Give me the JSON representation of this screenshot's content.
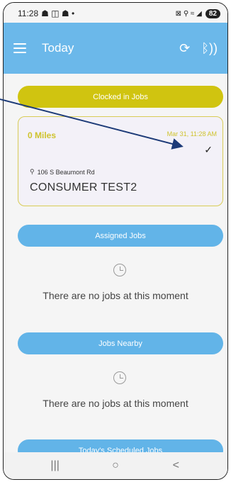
{
  "status_bar": {
    "time": "11:28",
    "left_icons": "☗ ◫ ☗ •",
    "right_icons": "⊠ ⚲ ≈ ◢",
    "battery": "82"
  },
  "header": {
    "title": "Today",
    "refresh_icon": "⟳",
    "bluetooth_icon": "ᛒ))"
  },
  "sections": {
    "clocked_in": "Clocked in Jobs",
    "assigned": "Assigned Jobs",
    "nearby": "Jobs Nearby",
    "scheduled": "Today's Scheduled Jobs"
  },
  "job_card": {
    "miles": "0 Miles",
    "time": "Mar 31, 11:28 AM",
    "check": "✓",
    "address": "106 S Beaumont Rd",
    "customer": "CONSUMER TEST2"
  },
  "empty_states": {
    "assigned": "There are no jobs at this moment",
    "nearby": "There are no jobs at this moment"
  },
  "nav": {
    "recents": "|||",
    "home": "○",
    "back": "<"
  },
  "colors": {
    "header": "#6bb8ea",
    "yellow": "#d0c410",
    "blue": "#62b4e8",
    "arrow": "#1d3b78"
  }
}
